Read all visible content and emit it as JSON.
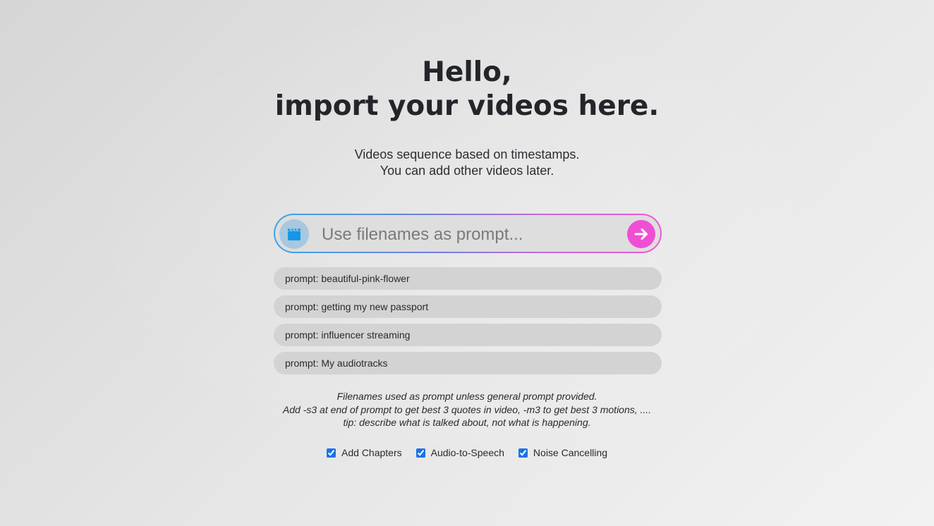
{
  "header": {
    "line1": "Hello,",
    "line2": "import your videos here."
  },
  "subtitle": {
    "line1": "Videos sequence based on timestamps.",
    "line2": "You can add other videos later."
  },
  "prompt": {
    "placeholder": "Use filenames as prompt...",
    "value": "",
    "left_icon": "clapperboard-icon",
    "submit_icon": "arrow-right-icon"
  },
  "suggestions": [
    "prompt: beautiful-pink-flower",
    "prompt: getting my new passport",
    "prompt: influencer streaming",
    "prompt: My audiotracks"
  ],
  "notes": {
    "line1": "Filenames used as prompt unless general prompt provided.",
    "line2": "Add -s3 at end of prompt to get best 3 quotes in video, -m3 to get best 3 motions, ....",
    "line3": "tip: describe what is talked about, not what is happening."
  },
  "options": [
    {
      "label": "Add Chapters",
      "checked": true
    },
    {
      "label": "Audio-to-Speech",
      "checked": true
    },
    {
      "label": "Noise Cancelling",
      "checked": true
    }
  ],
  "colors": {
    "accent_blue": "#3aa5ec",
    "accent_pink": "#f04fd4",
    "checkbox": "#1a73e8"
  }
}
